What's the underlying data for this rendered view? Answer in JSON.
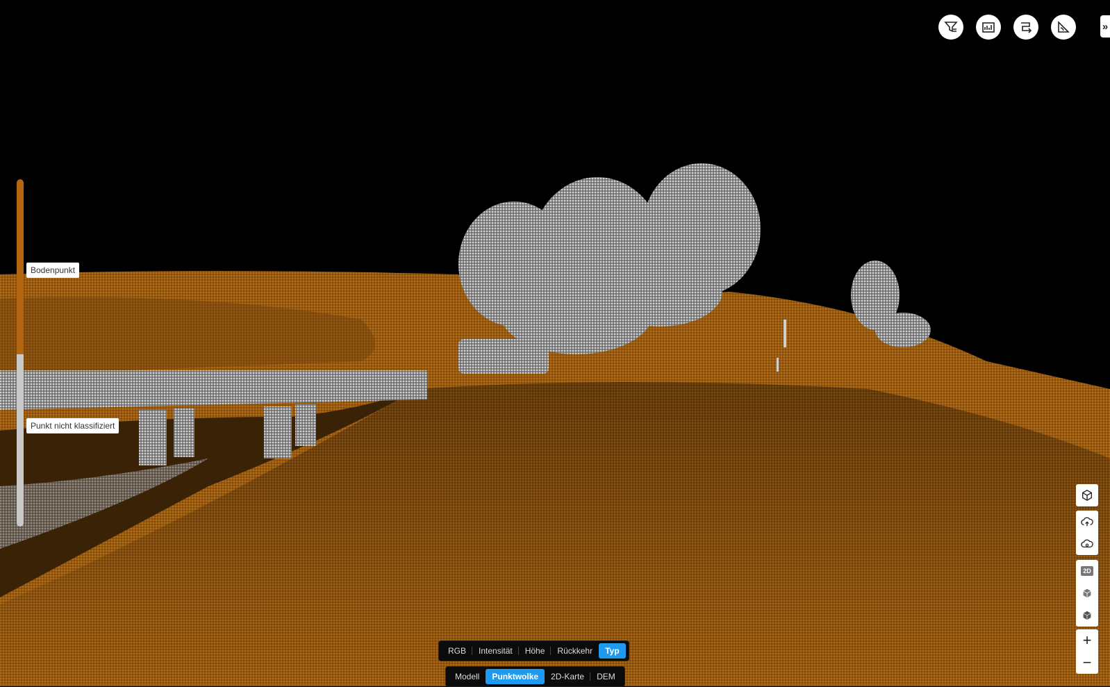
{
  "legend": {
    "colors": {
      "ground": "#b3660f",
      "unclassified": "#c9c9c9"
    },
    "items": [
      {
        "label": "Bodenpunkt"
      },
      {
        "label": "Punkt nicht klassifiziert"
      }
    ]
  },
  "top_tools": [
    {
      "icon": "filter-icon"
    },
    {
      "icon": "report-icon"
    },
    {
      "icon": "import-icon"
    },
    {
      "icon": "measure-icon"
    }
  ],
  "expand": {
    "label": "»"
  },
  "color_mode": {
    "options": [
      "RGB",
      "Intensität",
      "Höhe",
      "Rückkehr",
      "Typ"
    ],
    "selected": "Typ"
  },
  "view_mode": {
    "options": [
      "Modell",
      "Punktwolke",
      "2D-Karte",
      "DEM"
    ],
    "selected": "Punktwolke"
  },
  "side_controls": {
    "badge_2d": "2D",
    "zoom_in": "+",
    "zoom_out": "−"
  },
  "accent_color": "#1e9bf0"
}
